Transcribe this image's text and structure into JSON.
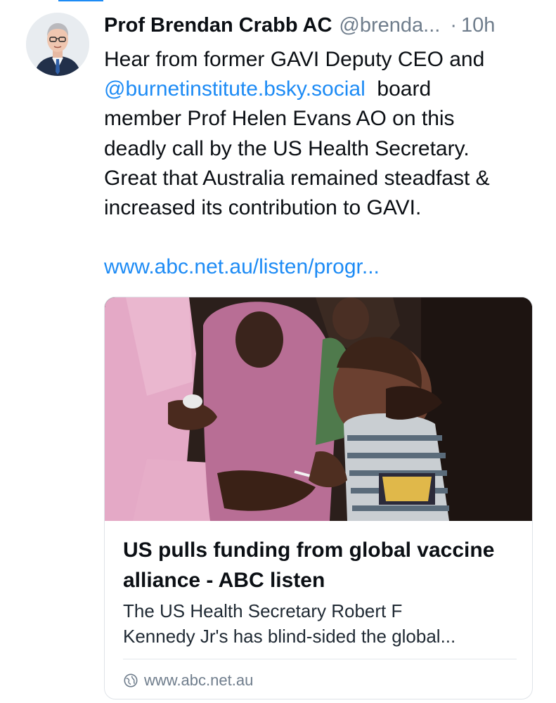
{
  "post": {
    "author": {
      "display_name": "Prof Brendan Crabb AC",
      "handle": "@brenda...",
      "separator": "·",
      "time": "10h"
    },
    "text_lines": [
      "Hear from former GAVI Deputy CEO and",
      "board",
      "member Prof Helen Evans AO on this",
      "deadly call by the US Health Secretary.",
      "Great that Australia remained steadfast &",
      "increased its contribution to GAVI."
    ],
    "mention": "@burnetinstitute.bsky.social",
    "link": "www.abc.net.au/listen/progr..."
  },
  "card": {
    "title_lines": [
      "US pulls funding from global vaccine",
      "alliance - ABC listen"
    ],
    "description_lines": [
      "The US Health Secretary Robert F",
      "Kennedy Jr's has blind-sided the global..."
    ],
    "domain": "www.abc.net.au",
    "domain_icon": "globe-icon"
  },
  "colors": {
    "accent": "#1d8bf5",
    "muted": "#6f7d8c",
    "text": "#0b0f14"
  }
}
